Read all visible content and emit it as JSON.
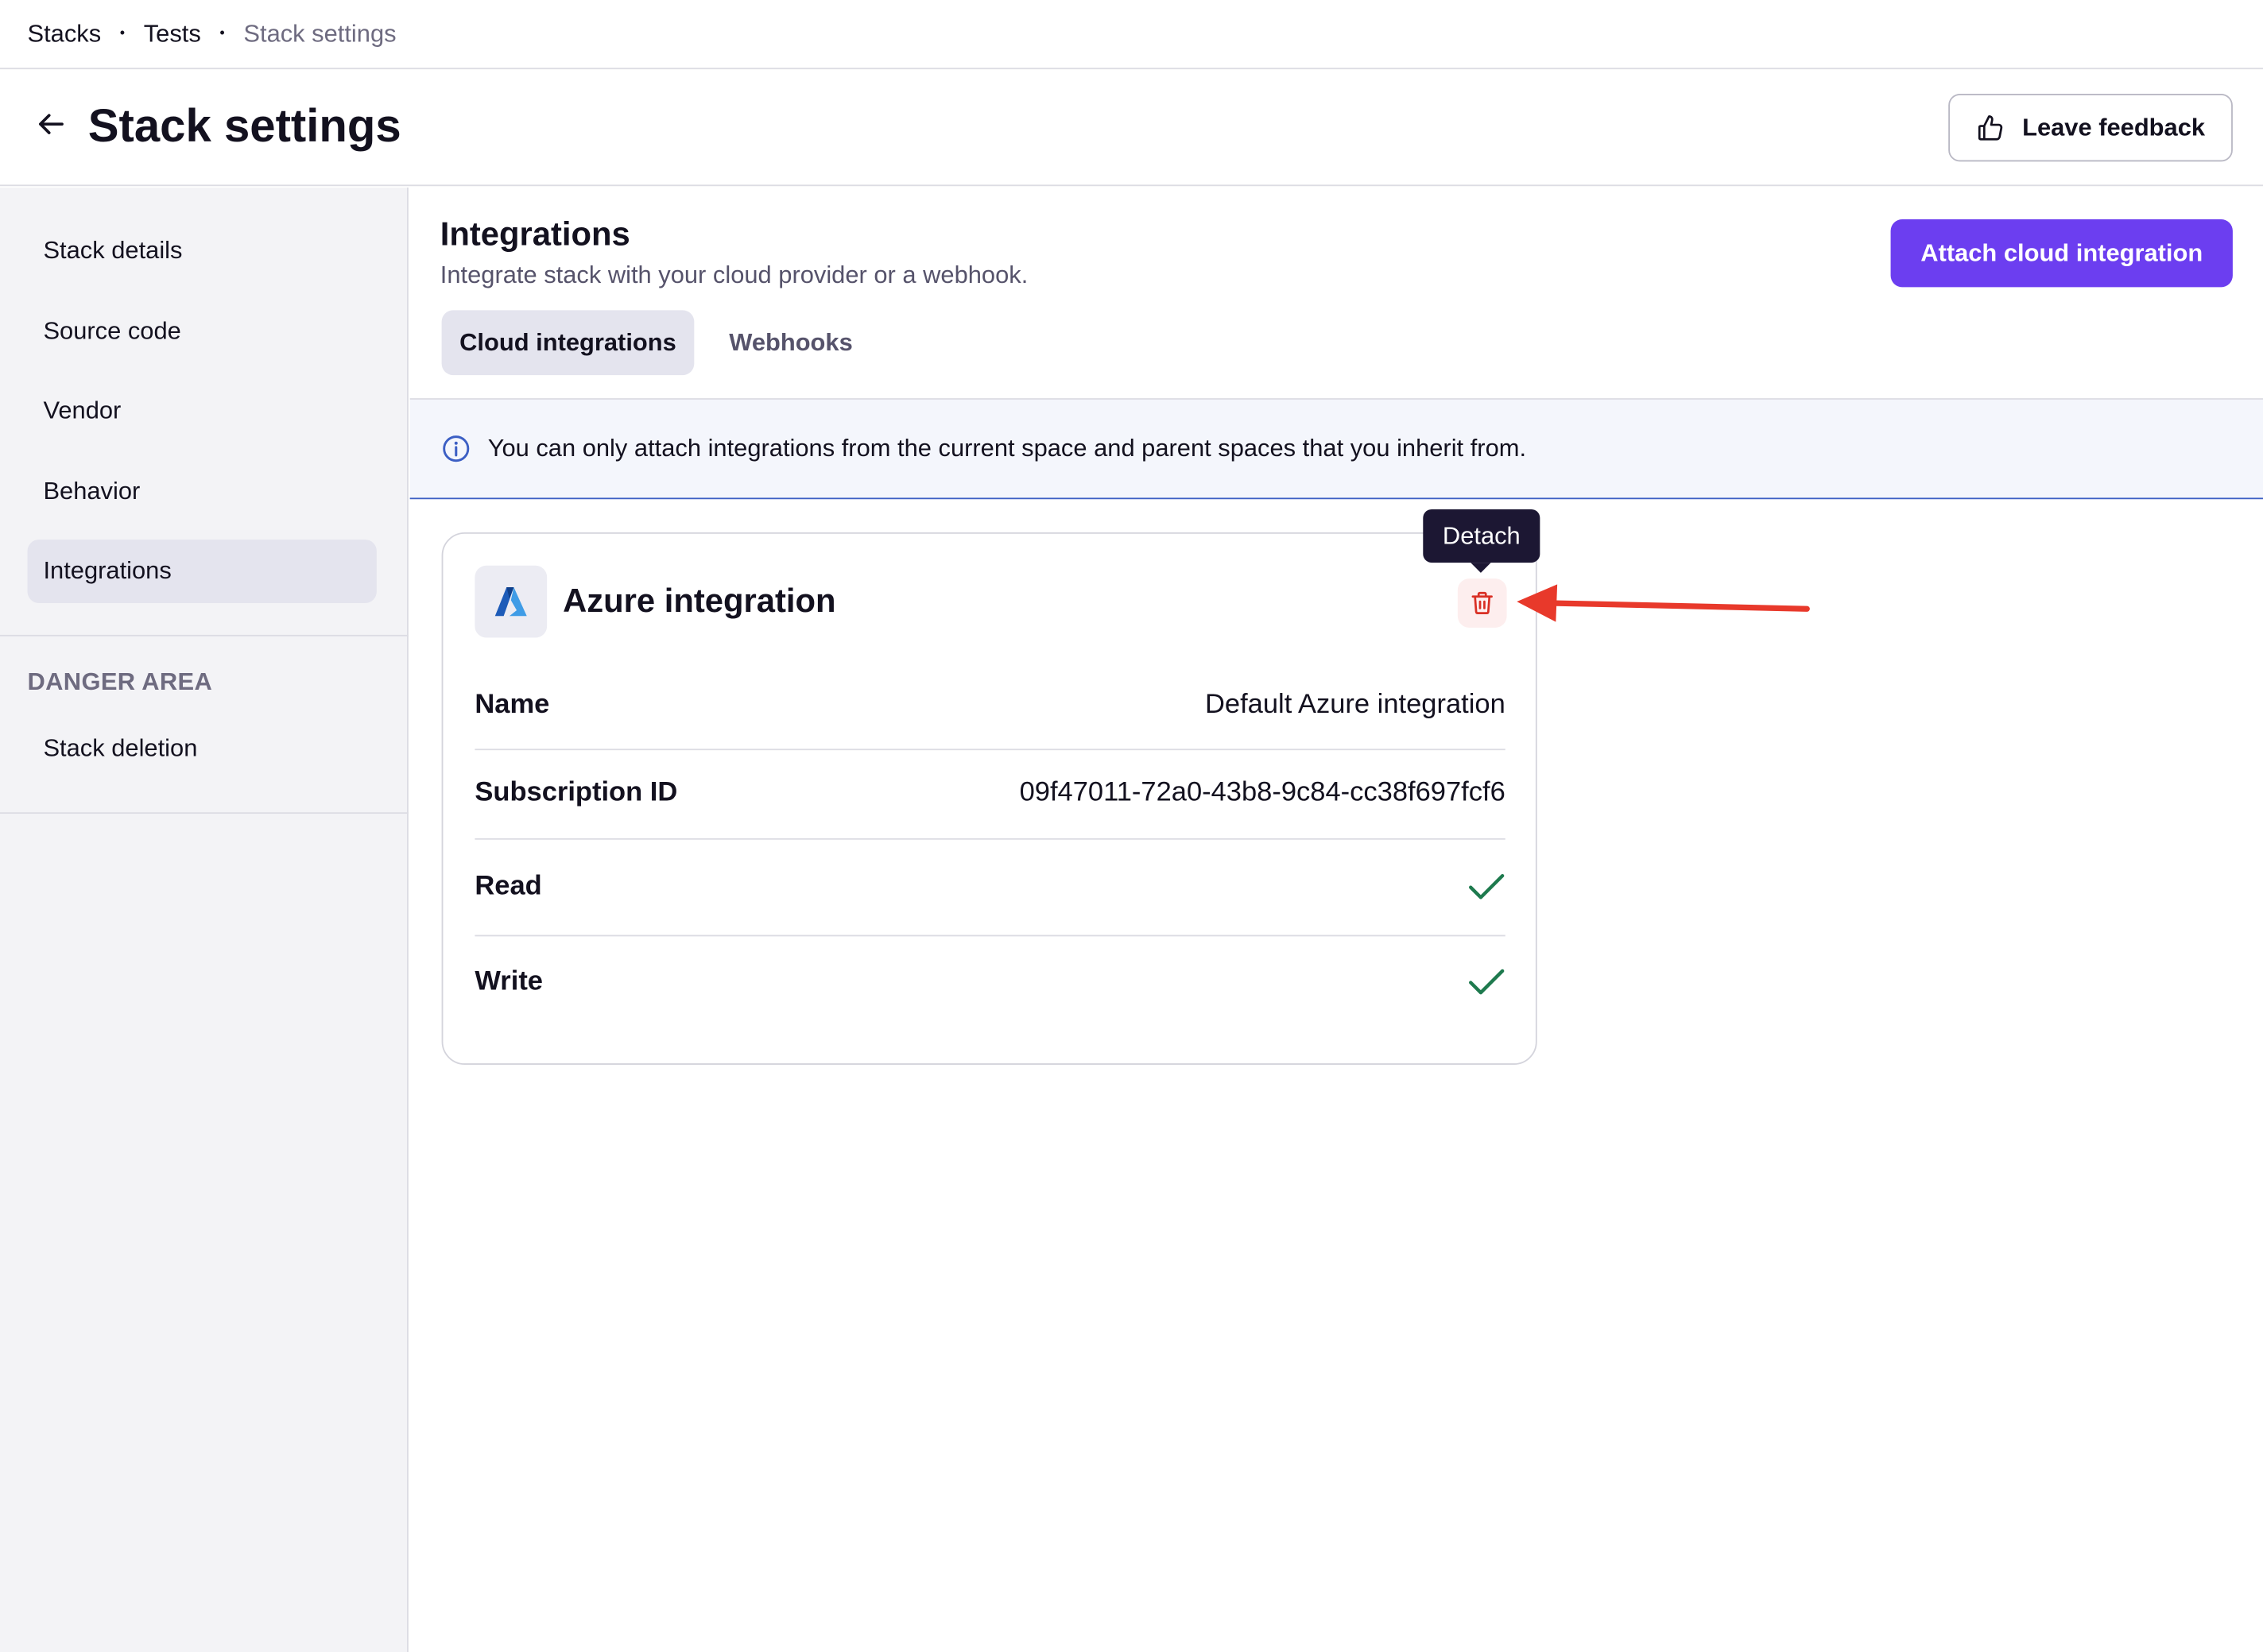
{
  "breadcrumb": {
    "items": [
      "Stacks",
      "Tests",
      "Stack settings"
    ],
    "separator": "•"
  },
  "header": {
    "title": "Stack settings",
    "feedback_label": "Leave feedback"
  },
  "sidebar": {
    "items": [
      {
        "label": "Stack details"
      },
      {
        "label": "Source code"
      },
      {
        "label": "Vendor"
      },
      {
        "label": "Behavior"
      },
      {
        "label": "Integrations",
        "active": true
      }
    ],
    "danger_section": {
      "title": "DANGER AREA",
      "items": [
        {
          "label": "Stack deletion"
        }
      ]
    }
  },
  "main": {
    "title": "Integrations",
    "subtitle": "Integrate stack with your cloud provider or a webhook.",
    "attach_button": "Attach cloud integration",
    "tabs": [
      {
        "label": "Cloud integrations",
        "active": true
      },
      {
        "label": "Webhooks",
        "active": false
      }
    ],
    "info_banner": "You can only attach integrations from the current space and parent spaces that you inherit from.",
    "card": {
      "title": "Azure integration",
      "icon": "azure-logo",
      "detach_tooltip": "Detach",
      "rows": [
        {
          "label": "Name",
          "value": "Default Azure integration"
        },
        {
          "label": "Subscription ID",
          "value": "09f47011-72a0-43b8-9c84-cc38f697fcf6"
        },
        {
          "label": "Read",
          "value": "",
          "checked": true
        },
        {
          "label": "Write",
          "value": "",
          "checked": true
        }
      ]
    }
  },
  "colors": {
    "accent": "#6c3ef0",
    "danger": "#d93025",
    "annotation_arrow": "#e8392b",
    "check": "#1e7a4e",
    "info": "#3c5fc4"
  }
}
